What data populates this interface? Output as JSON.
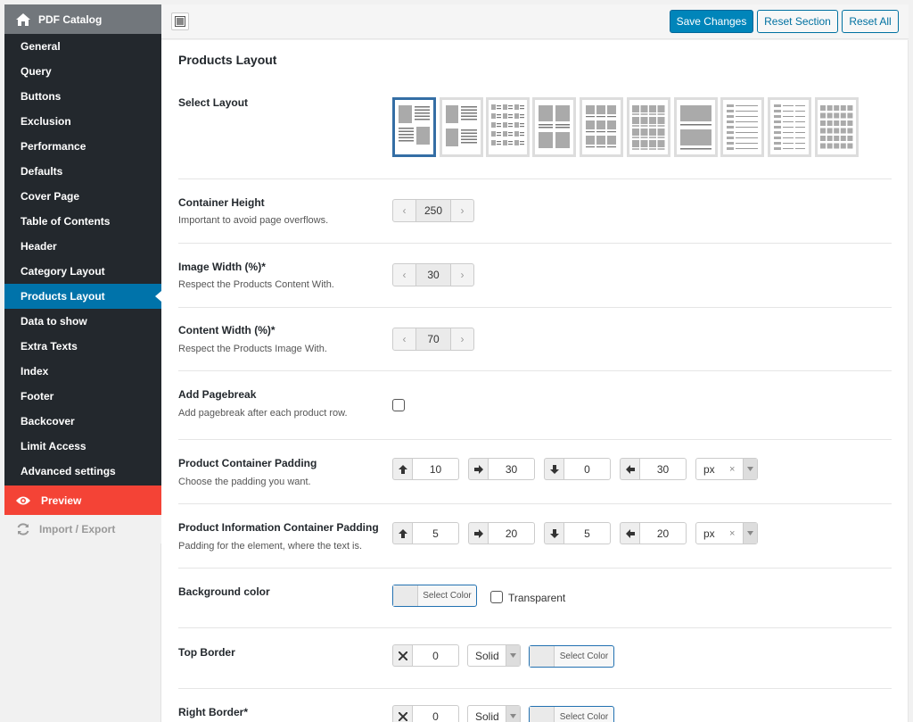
{
  "sidebar": {
    "title": "PDF Catalog",
    "items": [
      {
        "label": "General"
      },
      {
        "label": "Query"
      },
      {
        "label": "Buttons"
      },
      {
        "label": "Exclusion"
      },
      {
        "label": "Performance"
      },
      {
        "label": "Defaults"
      },
      {
        "label": "Cover Page"
      },
      {
        "label": "Table of Contents"
      },
      {
        "label": "Header"
      },
      {
        "label": "Category Layout"
      },
      {
        "label": "Products Layout",
        "active": true
      },
      {
        "label": "Data to show"
      },
      {
        "label": "Extra Texts"
      },
      {
        "label": "Index"
      },
      {
        "label": "Footer"
      },
      {
        "label": "Backcover"
      },
      {
        "label": "Limit Access"
      },
      {
        "label": "Advanced settings"
      }
    ],
    "preview_label": "Preview",
    "import_export_label": "Import / Export"
  },
  "toolbar": {
    "save_label": "Save Changes",
    "reset_section_label": "Reset Section",
    "reset_all_label": "Reset All"
  },
  "main": {
    "section_title": "Products Layout",
    "select_layout": {
      "label": "Select Layout",
      "selected_index": 0,
      "count": 10
    },
    "container_height": {
      "label": "Container Height",
      "desc": "Important to avoid page overflows.",
      "value": "250"
    },
    "image_width": {
      "label": "Image Width (%)*",
      "desc": "Respect the Products Content With.",
      "value": "30"
    },
    "content_width": {
      "label": "Content Width (%)*",
      "desc": "Respect the Products Image With.",
      "value": "70"
    },
    "pagebreak": {
      "label": "Add Pagebreak",
      "desc": "Add pagebreak after each product row.",
      "checked": false
    },
    "container_padding": {
      "label": "Product Container Padding",
      "desc": "Choose the padding you want.",
      "top": "10",
      "right": "30",
      "bottom": "0",
      "left": "30",
      "unit": "px"
    },
    "info_padding": {
      "label": "Product Information Container Padding",
      "desc": "Padding for the element, where the text is.",
      "top": "5",
      "right": "20",
      "bottom": "5",
      "left": "20",
      "unit": "px"
    },
    "background_color": {
      "label": "Background color",
      "button_label": "Select Color",
      "transparent_label": "Transparent"
    },
    "top_border": {
      "label": "Top Border",
      "width": "0",
      "style": "Solid",
      "color_button_label": "Select Color"
    },
    "right_border": {
      "label": "Right Border*",
      "width": "0",
      "style": "Solid",
      "color_button_label": "Select Color"
    }
  },
  "colors": {
    "accent": "#0073aa",
    "sidebar_bg": "#23282d",
    "preview_bg": "#f44336",
    "selected_layout_border": "#346ea5"
  }
}
